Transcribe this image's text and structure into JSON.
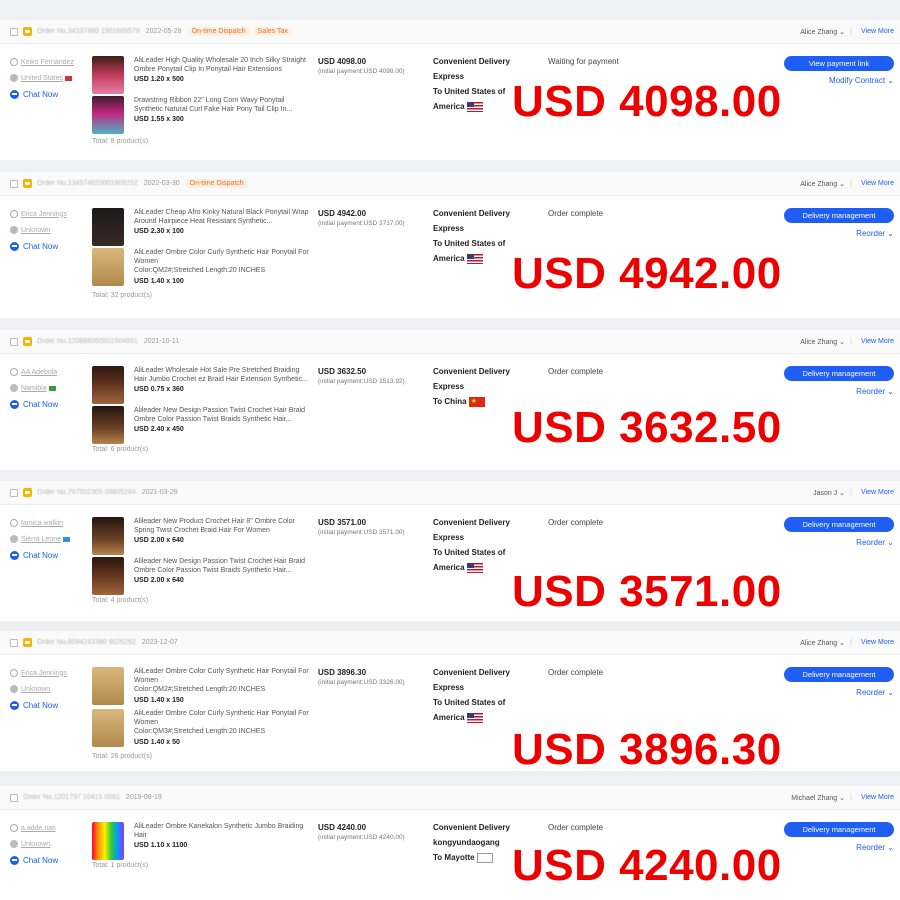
{
  "common": {
    "chat_label": "Chat Now",
    "view_more": "View More",
    "currency_prefix": "USD"
  },
  "orders": [
    {
      "order_no": "Order No.34337480 1501609578",
      "date": "2022-05-28",
      "tags": [
        "On-time Dispatch",
        "Sales Tax"
      ],
      "rep": "Alice Zhang",
      "buyer_name": "Keiko Fernandez",
      "buyer_country": "United States",
      "products": [
        {
          "title": "AliLeader High Quality Wholesale 20 Inch Silky Straight Ombre Ponytail Clip In Ponytail Hair Extensions",
          "spec": "",
          "qty": "USD 1.20 x 500"
        },
        {
          "title": "Drawstring Ribbon 22\" Long Corn Wavy Ponytail Synthetic Natural Curl Fake Hair Pony Tail Clip In...",
          "spec": "",
          "qty": "USD 1.55 x 300"
        }
      ],
      "total": "Total:  8 product(s)",
      "amount": "USD 4098.00",
      "initial_payment": "(initial payment:USD 4098.00)",
      "shipping_method": "Convenient Delivery Express",
      "shipping_dest": "To United States of America",
      "status": "Waiting for payment",
      "button": "View payment link",
      "link": "Modify Contract ⌄",
      "big_amount": "USD 4098.00"
    },
    {
      "order_no": "Order No.134574620001809252",
      "date": "2022-03-30",
      "tags": [
        "On-time Dispatch"
      ],
      "rep": "Alice Zhang",
      "buyer_name": "Erica Jennings",
      "buyer_country": "Unknown",
      "products": [
        {
          "title": "AliLeader Cheap Afro Kinky Natural Black Ponytail Wrap Around Hairpiece Heat Resistant Synthetic...",
          "spec": "",
          "qty": "USD 2.30 x 100"
        },
        {
          "title": "AliLeader Ombre Color Curly Synthetic Hair Ponytail For Women",
          "spec": "Color:QM2#;Stretched Length:20 INCHES",
          "qty": "USD 1.40 x 100"
        }
      ],
      "total": "Total:  32 product(s)",
      "amount": "USD 4942.00",
      "initial_payment": "(initial payment:USD 3717.00)",
      "shipping_method": "Convenient Delivery Express",
      "shipping_dest": "To United States of America",
      "status": "Order complete",
      "button": "Delivery management",
      "link": "Reorder ⌄",
      "big_amount": "USD 4942.00"
    },
    {
      "order_no": "Order No.120886050501504931",
      "date": "2021-10-11",
      "tags": [],
      "rep": "Alice Zhang",
      "buyer_name": "AA Adebola",
      "buyer_country": "Namibia",
      "products": [
        {
          "title": "AliLeader Wholesale Hot Sale Pre Stretched Braiding Hair Jumbo Crochet ez Braid Hair Extension Synthetic...",
          "spec": "",
          "qty": "USD 0.75 x 360"
        },
        {
          "title": "Alileader New Design Passion Twist Crochet Hair Braid Ombre Color Passion Twist Braids Synthetic Hair...",
          "spec": "",
          "qty": "USD 2.40 x 450"
        }
      ],
      "total": "Total:  6 product(s)",
      "amount": "USD 3632.50",
      "initial_payment": "(initial payment:USD 1513.92)",
      "shipping_method": "Convenient Delivery Express",
      "shipping_dest": "To China",
      "status": "Order complete",
      "button": "Delivery management",
      "link": "Reorder ⌄",
      "big_amount": "USD 3632.50"
    },
    {
      "order_no": "Order No.797502305 09805284",
      "date": "2021-03-29",
      "tags": [],
      "rep": "Jason J",
      "buyer_name": "tamica walkin",
      "buyer_country": "Sierra Leone",
      "products": [
        {
          "title": "Alileader New Product Crochet Hair 8\" Ombre Color Spring Twist Crochet Braid Hair For Women",
          "spec": "",
          "qty": "USD 2.00 x 640"
        },
        {
          "title": "Alileader New Design Passion Twist Crochet Hair Braid Ombre Color Passion Twist Braids Synthetic Hair...",
          "spec": "",
          "qty": "USD 2.00 x 640"
        }
      ],
      "total": "Total:  4 product(s)",
      "amount": "USD 3571.00",
      "initial_payment": "(initial payment:USD 3571.00)",
      "shipping_method": "Convenient Delivery Express",
      "shipping_dest": "To United States of America",
      "status": "Order complete",
      "button": "Delivery management",
      "link": "Reorder ⌄",
      "big_amount": "USD 3571.00"
    },
    {
      "order_no": "Order No.8094243380 9026262",
      "date": "2023-12-07",
      "tags": [],
      "rep": "Alice Zhang",
      "buyer_name": "Erica Jennings",
      "buyer_country": "Unknown",
      "products": [
        {
          "title": "AliLeader Ombre Color Curly Synthetic Hair Ponytail For Women",
          "spec": "Color:QM2#;Stretched Length:20 INCHES",
          "qty": "USD 1.40 x 150"
        },
        {
          "title": "AliLeader Ombre Color Curly Synthetic Hair Ponytail For Women",
          "spec": "Color:QM3#;Stretched Length:20 INCHES",
          "qty": "USD 1.40 x 50"
        }
      ],
      "total": "Total:  26 product(s)",
      "amount": "USD 3896.30",
      "initial_payment": "(initial payment:USD 3326.00)",
      "shipping_method": "Convenient Delivery Express",
      "shipping_dest": "To United States of America",
      "status": "Order complete",
      "button": "Delivery management",
      "link": "Reorder ⌄",
      "big_amount": "USD 3896.30"
    },
    {
      "order_no": "Order No.1201797 10415 0081",
      "date": "2019-08-19",
      "tags": [],
      "rep": "Michael Zhang",
      "buyer_name": "a.adde.nas",
      "buyer_country": "Unknown",
      "products": [
        {
          "title": "AliLeader Ombre Kanekalon Synthetic Jumbo Braiding Hair",
          "spec": "",
          "qty": "USD 1.10 x 1100"
        }
      ],
      "total": "Total:  1 product(s)",
      "amount": "USD 4240.00",
      "initial_payment": "(initial payment:USD 4240.00)",
      "shipping_method": "Convenient Delivery kongyundaogang",
      "shipping_dest": "To Mayotte",
      "status": "Order complete",
      "button": "Delivery management",
      "link": "Reorder ⌄",
      "big_amount": "USD 4240.00"
    }
  ]
}
